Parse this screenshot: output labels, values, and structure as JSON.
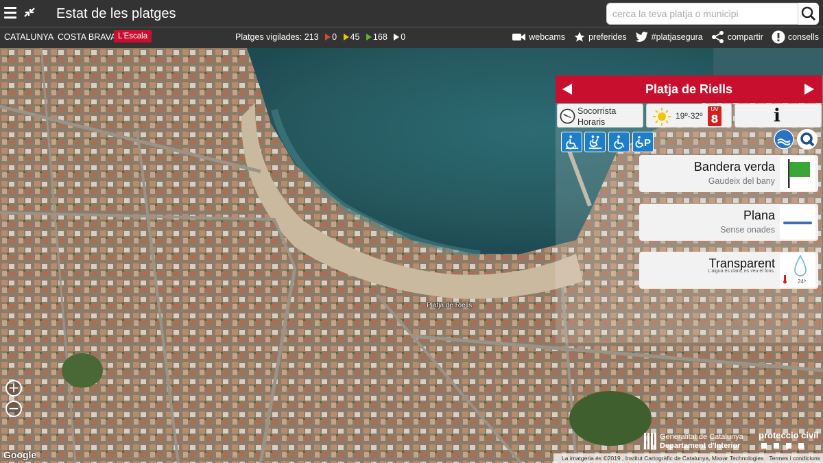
{
  "app": {
    "title": "Estat de les platges"
  },
  "search": {
    "placeholder": "cerca la teva platja o municipi"
  },
  "breadcrumb": {
    "region": "CATALUNYA",
    "area": "COSTA BRAVA",
    "municipality": "L'Escala"
  },
  "stats": {
    "label": "Platges vigilades: 213",
    "red": "0",
    "yellow": "45",
    "green": "168",
    "none": "0",
    "colors": {
      "red": "#e2452e",
      "yellow": "#f0c500",
      "green": "#5db533",
      "none": "#ffffff"
    }
  },
  "tools": {
    "webcams": "webcams",
    "favorites": "preferides",
    "hashtag": "#platjasegura",
    "share": "compartir",
    "tips": "consells"
  },
  "map": {
    "beach_label": "Platja de Riells",
    "attribution": "La imatgeria és ©2019 , Institut Cartogràfic de Catalunya, Maxar Technologies",
    "terms": "Termes i condicions",
    "google": "Google",
    "zoom_in": "+",
    "zoom_out": "−"
  },
  "footer": {
    "gencat_line1": "Generalitat de Catalunya",
    "gencat_line2": "Departament d'Interior",
    "civil_protection": "proteccio civil"
  },
  "panel": {
    "beach_name": "Platja de Riells",
    "lifeguard_line1": "Socorrista",
    "lifeguard_line2": "Horaris",
    "temperature": "19º-32º",
    "uv_label": "UV",
    "uv_value": "8",
    "info_glyph": "i",
    "accessibility_icons": [
      "wheelchair-access-icon",
      "assisted-bathing-icon",
      "adapted-access-icon",
      "disabled-parking-icon"
    ],
    "flag": {
      "title": "Bandera verda",
      "subtitle": "Gaudeix del bany",
      "color": "#3aa637"
    },
    "waves": {
      "title": "Plana",
      "subtitle": "Sense onades",
      "color": "#3a6fb5"
    },
    "water": {
      "title": "Transparent",
      "subtitle": "L'aigua és clara, es veu el fons.",
      "water_temp": "24º"
    }
  },
  "accent": "#c8102e"
}
